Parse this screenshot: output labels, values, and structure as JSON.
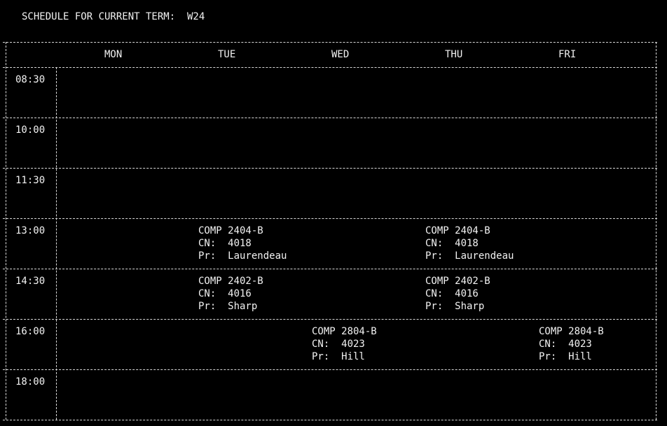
{
  "title": "SCHEDULE FOR CURRENT TERM:  W24",
  "days": [
    "MON",
    "TUE",
    "WED",
    "THU",
    "FRI"
  ],
  "times": [
    "08:30",
    "10:00",
    "11:30",
    "13:00",
    "14:30",
    "16:00",
    "18:00"
  ],
  "labels": {
    "cn": "CN:",
    "pr": "Pr:"
  },
  "courses": [
    {
      "day": "TUE",
      "time": "13:00",
      "code": "COMP 2404-B",
      "cn": "4018",
      "prof": "Laurendeau"
    },
    {
      "day": "THU",
      "time": "13:00",
      "code": "COMP 2404-B",
      "cn": "4018",
      "prof": "Laurendeau"
    },
    {
      "day": "TUE",
      "time": "14:30",
      "code": "COMP 2402-B",
      "cn": "4016",
      "prof": "Sharp"
    },
    {
      "day": "THU",
      "time": "14:30",
      "code": "COMP 2402-B",
      "cn": "4016",
      "prof": "Sharp"
    },
    {
      "day": "WED",
      "time": "16:00",
      "code": "COMP 2804-B",
      "cn": "4023",
      "prof": "Hill"
    },
    {
      "day": "FRI",
      "time": "16:00",
      "code": "COMP 2804-B",
      "cn": "4023",
      "prof": "Hill"
    }
  ]
}
